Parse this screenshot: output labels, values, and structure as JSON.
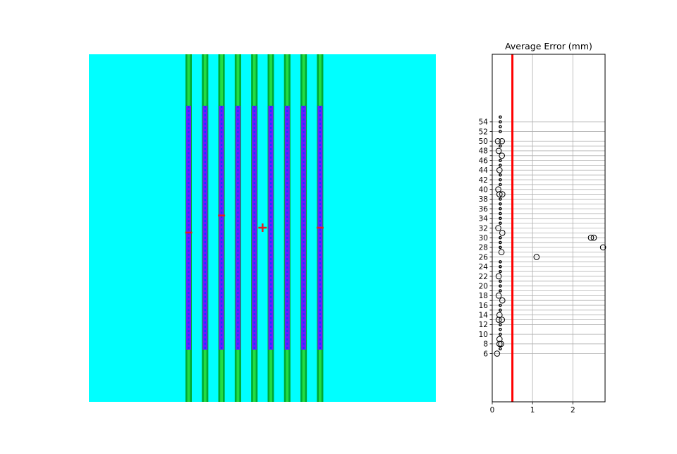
{
  "colors": {
    "background": "#00ffff",
    "band_dark": "#00aa33",
    "band_light": "#22dd44",
    "fiber": "#6a1bff",
    "fiber_dash": "#1f34ff",
    "marker": "#e02020",
    "threshold": "#ff0000",
    "grid": "#b0b0b0"
  },
  "image_panel": {
    "strip_count": 9,
    "markers": [
      {
        "kind": "tick",
        "strip": 0,
        "level": 0.52
      },
      {
        "kind": "tick",
        "strip": 2,
        "level": 0.45
      },
      {
        "kind": "plus",
        "strip": 4.5,
        "level": 0.5
      },
      {
        "kind": "tick",
        "strip": 8,
        "level": 0.5
      }
    ]
  },
  "chart_data": [
    {
      "type": "scatter",
      "title": "Average Error (mm)",
      "xlabel": "",
      "ylabel": "",
      "xlim": [
        0,
        2.8
      ],
      "ylim": [
        -4,
        68
      ],
      "x_ticks": [
        0,
        1,
        2
      ],
      "x_tick_labels": [
        "0",
        "1",
        "2"
      ],
      "y_ticks": [
        6,
        8,
        10,
        12,
        13,
        14,
        15,
        16,
        17,
        18,
        19,
        20,
        21,
        22,
        23,
        24,
        25,
        26,
        27,
        28,
        29,
        30,
        31,
        32,
        33,
        34,
        35,
        36,
        37,
        38,
        39,
        40,
        41,
        42,
        43,
        44,
        45,
        46,
        47,
        48,
        49,
        50,
        52,
        54
      ],
      "y_tick_labels": [
        "6",
        "8",
        "10",
        "12",
        "14",
        "16",
        "18",
        "20",
        "22",
        "24",
        "26",
        "28",
        "30",
        "32",
        "34",
        "36",
        "38",
        "40",
        "42",
        "44",
        "46",
        "48",
        "50",
        "52",
        "54"
      ],
      "grid": true,
      "threshold_x": 0.5,
      "points": [
        {
          "x": 0.12,
          "y": 6,
          "size": "large"
        },
        {
          "x": 0.2,
          "y": 7,
          "size": "small"
        },
        {
          "x": 0.18,
          "y": 8,
          "size": "large"
        },
        {
          "x": 0.22,
          "y": 8,
          "size": "large"
        },
        {
          "x": 0.18,
          "y": 9,
          "size": "large"
        },
        {
          "x": 0.2,
          "y": 10,
          "size": "small"
        },
        {
          "x": 0.2,
          "y": 11,
          "size": "small"
        },
        {
          "x": 0.2,
          "y": 12,
          "size": "small"
        },
        {
          "x": 0.16,
          "y": 13,
          "size": "large"
        },
        {
          "x": 0.24,
          "y": 13,
          "size": "large"
        },
        {
          "x": 0.18,
          "y": 14,
          "size": "large"
        },
        {
          "x": 0.2,
          "y": 15,
          "size": "small"
        },
        {
          "x": 0.2,
          "y": 16,
          "size": "small"
        },
        {
          "x": 0.25,
          "y": 17,
          "size": "large"
        },
        {
          "x": 0.16,
          "y": 18,
          "size": "large"
        },
        {
          "x": 0.2,
          "y": 19,
          "size": "small"
        },
        {
          "x": 0.2,
          "y": 20,
          "size": "small"
        },
        {
          "x": 0.2,
          "y": 21,
          "size": "small"
        },
        {
          "x": 0.16,
          "y": 22,
          "size": "large"
        },
        {
          "x": 0.2,
          "y": 23,
          "size": "small"
        },
        {
          "x": 0.2,
          "y": 24,
          "size": "small"
        },
        {
          "x": 0.2,
          "y": 25,
          "size": "small"
        },
        {
          "x": 1.1,
          "y": 26,
          "size": "large"
        },
        {
          "x": 0.23,
          "y": 27,
          "size": "large"
        },
        {
          "x": 0.2,
          "y": 28,
          "size": "small"
        },
        {
          "x": 2.75,
          "y": 28,
          "size": "large"
        },
        {
          "x": 0.2,
          "y": 29,
          "size": "small"
        },
        {
          "x": 0.2,
          "y": 30,
          "size": "small"
        },
        {
          "x": 2.45,
          "y": 30,
          "size": "large"
        },
        {
          "x": 2.52,
          "y": 30,
          "size": "large"
        },
        {
          "x": 0.25,
          "y": 31,
          "size": "large"
        },
        {
          "x": 0.15,
          "y": 32,
          "size": "large"
        },
        {
          "x": 0.2,
          "y": 33,
          "size": "small"
        },
        {
          "x": 0.2,
          "y": 34,
          "size": "small"
        },
        {
          "x": 0.2,
          "y": 35,
          "size": "small"
        },
        {
          "x": 0.2,
          "y": 36,
          "size": "small"
        },
        {
          "x": 0.2,
          "y": 37,
          "size": "small"
        },
        {
          "x": 0.2,
          "y": 38,
          "size": "small"
        },
        {
          "x": 0.25,
          "y": 39,
          "size": "large"
        },
        {
          "x": 0.18,
          "y": 39,
          "size": "large"
        },
        {
          "x": 0.15,
          "y": 40,
          "size": "large"
        },
        {
          "x": 0.2,
          "y": 41,
          "size": "small"
        },
        {
          "x": 0.2,
          "y": 42,
          "size": "small"
        },
        {
          "x": 0.2,
          "y": 43,
          "size": "small"
        },
        {
          "x": 0.18,
          "y": 44,
          "size": "large"
        },
        {
          "x": 0.2,
          "y": 45,
          "size": "small"
        },
        {
          "x": 0.2,
          "y": 46,
          "size": "small"
        },
        {
          "x": 0.24,
          "y": 47,
          "size": "large"
        },
        {
          "x": 0.16,
          "y": 48,
          "size": "large"
        },
        {
          "x": 0.2,
          "y": 49,
          "size": "small"
        },
        {
          "x": 0.14,
          "y": 50,
          "size": "large"
        },
        {
          "x": 0.24,
          "y": 50,
          "size": "large"
        },
        {
          "x": 0.2,
          "y": 52,
          "size": "small"
        },
        {
          "x": 0.2,
          "y": 53,
          "size": "small"
        },
        {
          "x": 0.2,
          "y": 54,
          "size": "small"
        },
        {
          "x": 0.2,
          "y": 55,
          "size": "small"
        }
      ]
    }
  ]
}
